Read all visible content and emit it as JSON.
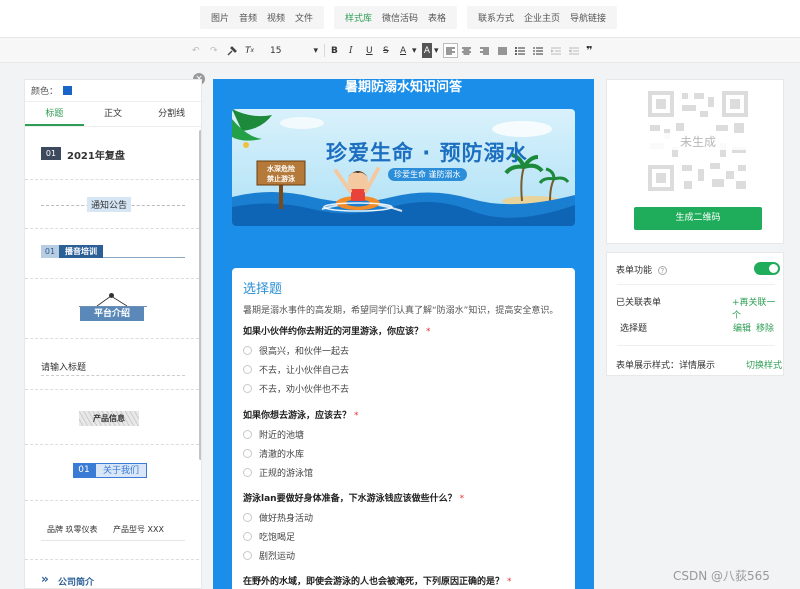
{
  "menu": {
    "group1": [
      "图片",
      "音频",
      "视频",
      "文件"
    ],
    "group2": [
      "样式库",
      "微信活码",
      "表格"
    ],
    "group3": [
      "联系方式",
      "企业主页",
      "导航链接"
    ],
    "active": "样式库"
  },
  "format_toolbar": {
    "font_size": "15",
    "bold": "B",
    "italic": "I",
    "underline": "U",
    "strike": "S",
    "font_color": "A",
    "bg_color": "A",
    "quote": "❞"
  },
  "left_panel": {
    "color_label": "颜色：",
    "color_value": "#1a63c7",
    "tabs": [
      "标题",
      "正文",
      "分割线"
    ],
    "samples": {
      "s1_num": "01",
      "s1_text": "2021年复盘",
      "s2_text": "通知公告",
      "s3_num": "01",
      "s3_text": "播音培训",
      "s4_text": "平台介绍",
      "s5_text": "请输入标题",
      "s6_text": "产品信息",
      "s7_num": "01",
      "s7_text": "关于我们",
      "s8_brand": "品牌 玖零仪表",
      "s8_model": "产品型号 XXX",
      "s9_text": "公司简介"
    }
  },
  "phone": {
    "title": "暑期防溺水知识问答",
    "banner": {
      "headline": "珍爱生命 · 预防溺水",
      "subline": "珍爱生命 谨防溺水",
      "sign_line1": "水深危险",
      "sign_line2": "禁止游泳"
    },
    "section_title": "选择题",
    "description": "暑期是溺水事件的高发期，希望同学们认真了解“防溺水”知识，提高安全意识。",
    "questions": [
      {
        "text": "如果小伙伴约你去附近的河里游泳，你应该？",
        "required": "*",
        "options": [
          "很高兴，和伙伴一起去",
          "不去，让小伙伴自己去",
          "不去，劝小伙伴也不去"
        ]
      },
      {
        "text": "如果你想去游泳，应该去？",
        "required": "*",
        "options": [
          "附近的池塘",
          "清澈的水库",
          "正规的游泳馆"
        ]
      },
      {
        "text": "游泳lan要做好身体准备，下水游泳钱应该做些什么？",
        "required": "*",
        "options": [
          "做好热身活动",
          "吃饱喝足",
          "剧烈运动"
        ]
      },
      {
        "text": "在野外的水域，即使会游泳的人也会被淹死，下列原因正确的是？",
        "required": "*",
        "options": []
      }
    ]
  },
  "qr_panel": {
    "placeholder_text": "未生成",
    "generate_button": "生成二维码"
  },
  "form_panel": {
    "form_function_label": "表单功能",
    "help_mark": "?",
    "linked_label": "已关联表单",
    "relink_link": "+再关联一个",
    "linked_item": "选择题",
    "edit_link": "编辑",
    "remove_link": "移除",
    "display_style_label": "表单展示样式：",
    "display_style_value": "详情展示",
    "switch_style_link": "切换样式"
  },
  "watermark": "CSDN @八荻565",
  "colors": {
    "accent_green": "#1fad5b",
    "phone_blue": "#1a8ee9",
    "title_blue": "#2b8fd6"
  }
}
